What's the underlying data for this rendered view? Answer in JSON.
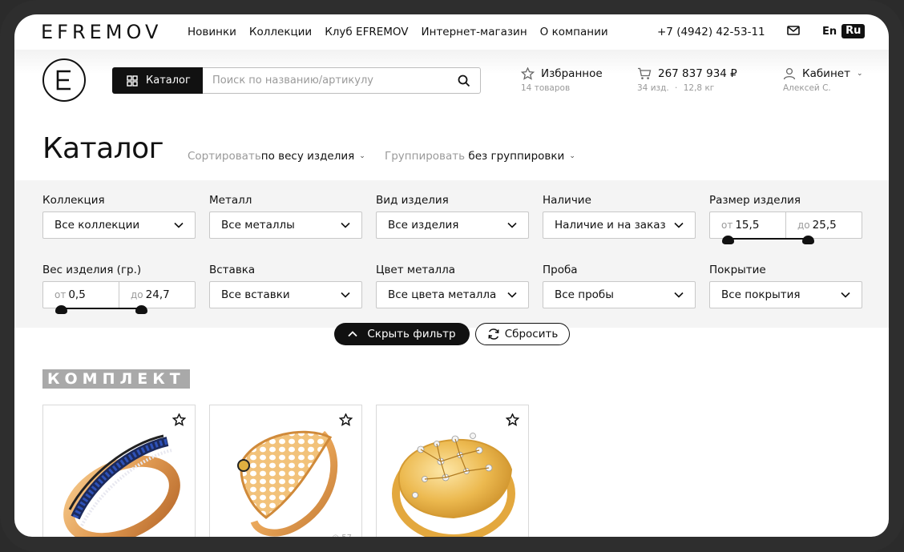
{
  "brand": "EFREMOV",
  "nav": [
    "Новинки",
    "Коллекции",
    "Клуб EFREMOV",
    "Интернет-магазин",
    "О компании"
  ],
  "phone": "+7 (4942) 42-53-11",
  "lang": {
    "en": "En",
    "ru": "Ru"
  },
  "header": {
    "catalog_button": "Каталог",
    "search_placeholder": "Поиск по названию/артикулу",
    "favorites": {
      "label": "Избранное",
      "sub": "14 товаров"
    },
    "cart": {
      "label": "267 837 934 ₽",
      "sub_count": "34 изд.",
      "sub_weight": "12,8 кг"
    },
    "cabinet": {
      "label": "Кабинет",
      "sub": "Алексей С."
    }
  },
  "page": {
    "title": "Каталог",
    "sort_label": "Сортировать",
    "sort_value": "по весу изделия",
    "group_label": "Группировать",
    "group_value": "без группировки"
  },
  "filters": {
    "collection": {
      "label": "Коллекция",
      "value": "Все коллекции"
    },
    "metal": {
      "label": "Металл",
      "value": "Все металлы"
    },
    "item_type": {
      "label": "Вид изделия",
      "value": "Все изделия"
    },
    "availability": {
      "label": "Наличие",
      "value": "Наличие и на заказ"
    },
    "size": {
      "label": "Размер изделия",
      "from_prefix": "от",
      "from": "15,5",
      "to_prefix": "до",
      "to": "25,5"
    },
    "weight": {
      "label": "Вес изделия (гр.)",
      "from_prefix": "от",
      "from": "0,5",
      "to_prefix": "до",
      "to": "24,7"
    },
    "insert": {
      "label": "Вставка",
      "value": "Все вставки"
    },
    "metal_color": {
      "label": "Цвет металла",
      "value": "Все цвета металла"
    },
    "assay": {
      "label": "Проба",
      "value": "Все пробы"
    },
    "coating": {
      "label": "Покрытие",
      "value": "Все покрытия"
    },
    "hide_button": "Скрыть фильтр",
    "reset_button": "Сбросить"
  },
  "section_tag": "КОМПЛЕКТ",
  "products": [
    {
      "name": "ring-blue-stones"
    },
    {
      "name": "ring-honeycomb",
      "views": "57"
    },
    {
      "name": "ring-diamond-grid"
    }
  ],
  "colors": {
    "accent": "#111111",
    "panel": "#f4f4f4",
    "gold": "#e9a95a",
    "tag": "#a9a9a9"
  }
}
